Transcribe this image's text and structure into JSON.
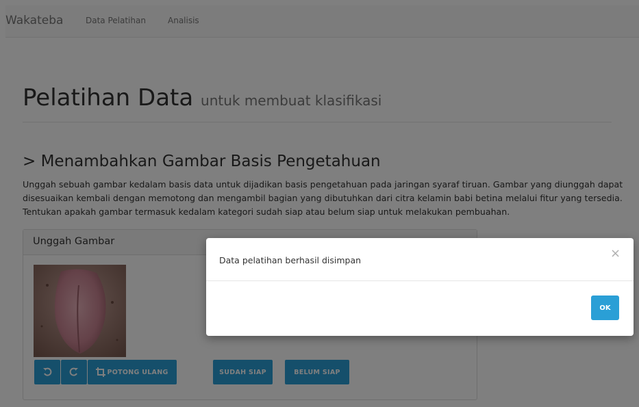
{
  "navbar": {
    "brand": "Wakateba",
    "links": [
      "Data Pelatihan",
      "Analisis"
    ]
  },
  "header": {
    "title": "Pelatihan Data",
    "subtitle": "untuk membuat klasifikasi"
  },
  "section": {
    "title": "> Menambahkan Gambar Basis Pengetahuan",
    "description": "Unggah sebuah gambar kedalam basis data untuk dijadikan basis pengetahuan pada jaringan syaraf tiruan. Gambar yang diunggah dapat disesuaikan kembali dengan memotong dan mengambil bagian yang dibutuhkan dari citra kelamin babi betina melalui fitur yang tersedia. Tentukan apakah gambar termasuk kedalam kategori sudah siap atau belum siap untuk melakukan pembuahan."
  },
  "panel": {
    "heading": "Unggah Gambar",
    "buttons": {
      "rotate_left_icon": "rotate-left-icon",
      "rotate_right_icon": "rotate-right-icon",
      "crop_icon": "crop-icon",
      "crop_label": "POTONG ULANG",
      "ready_label": "SUDAH SIAP",
      "not_ready_label": "BELUM SIAP"
    }
  },
  "modal": {
    "message": "Data pelatihan berhasil disimpan",
    "close": "×",
    "ok_label": "OK"
  },
  "colors": {
    "primary": "#2a9fd6",
    "backdrop": "rgba(0,0,0,0.5)",
    "navbar_bg": "#f8f8f8"
  }
}
